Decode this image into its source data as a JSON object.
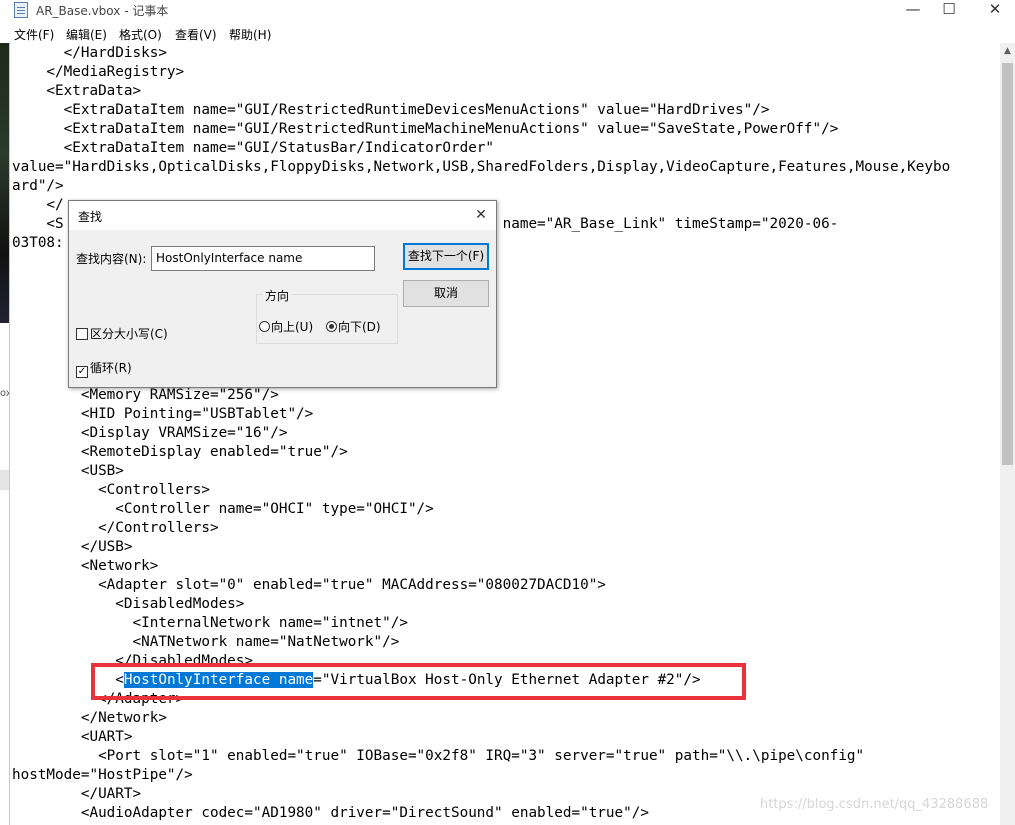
{
  "window": {
    "title": "AR_Base.vbox - 记事本",
    "minimize": "—",
    "maximize": "☐",
    "close": "✕"
  },
  "menu": [
    "文件(F)",
    "编辑(E)",
    "格式(O)",
    "查看(V)",
    "帮助(H)"
  ],
  "editor": {
    "lines": [
      "      </HardDisks>",
      "    </MediaRegistry>",
      "    <ExtraData>",
      "      <ExtraDataItem name=\"GUI/RestrictedRuntimeDevicesMenuActions\" value=\"HardDrives\"/>",
      "      <ExtraDataItem name=\"GUI/RestrictedRuntimeMachineMenuActions\" value=\"SaveState,PowerOff\"/>",
      "      <ExtraDataItem name=\"GUI/StatusBar/IndicatorOrder\"",
      "value=\"HardDisks,OpticalDisks,FloppyDisks,Network,USB,SharedFolders,Display,VideoCapture,Features,Mouse,Keybo",
      "ard\"/>",
      "    </",
      "    <S                                             2d4}\" name=\"AR_Base_Link\" timeStamp=\"2020-06-",
      "03T08:",
      "        ",
      "",
      "",
      "",
      "",
      "",
      "",
      "        <Memory RAMSize=\"256\"/>",
      "        <HID Pointing=\"USBTablet\"/>",
      "        <Display VRAMSize=\"16\"/>",
      "        <RemoteDisplay enabled=\"true\"/>",
      "        <USB>",
      "          <Controllers>",
      "            <Controller name=\"OHCI\" type=\"OHCI\"/>",
      "          </Controllers>",
      "        </USB>",
      "        <Network>",
      "          <Adapter slot=\"0\" enabled=\"true\" MACAddress=\"080027DACD10\">",
      "            <DisabledModes>",
      "              <InternalNetwork name=\"intnet\"/>",
      "              <NATNetwork name=\"NatNetwork\"/>",
      "            </DisabledModes>",
      "",
      "          </Adapter>",
      "        </Network>",
      "        <UART>",
      "          <Port slot=\"1\" enabled=\"true\" IOBase=\"0x2f8\" IRQ=\"3\" server=\"true\" path=\"\\\\.\\pipe\\config\"",
      "hostMode=\"HostPipe\"/>",
      "        </UART>",
      "        <AudioAdapter codec=\"AD1980\" driver=\"DirectSound\" enabled=\"true\"/>"
    ],
    "highlighted_line": {
      "indent": "            <",
      "selected": "HostOnlyInterface name",
      "rest": "=\"VirtualBox Host-Only Ethernet Adapter #2\"/>"
    }
  },
  "find_dialog": {
    "title": "查找",
    "close": "✕",
    "find_label": "查找内容(N):",
    "find_value": "HostOnlyInterface name",
    "find_next": "查找下一个(F)",
    "cancel": "取消",
    "direction_label": "方向",
    "up": "向上(U)",
    "down": "向下(D)",
    "match_case": "区分大小写(C)",
    "wrap_around": "循环(R)",
    "check_mark": "✓"
  },
  "left_fragment": "ox",
  "watermark": "https://blog.csdn.net/qq_43288688"
}
